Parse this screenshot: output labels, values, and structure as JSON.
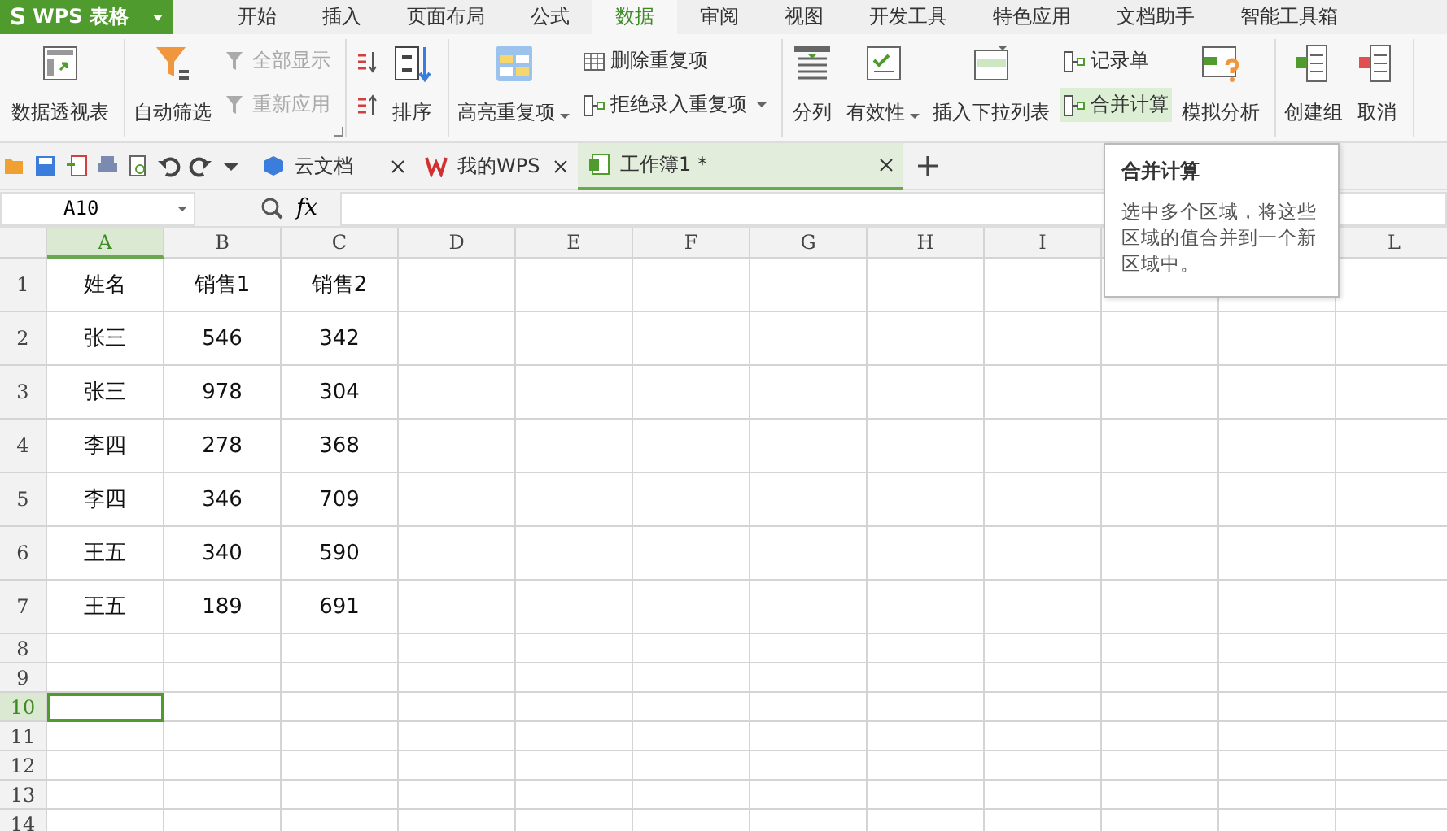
{
  "app": {
    "logo": "S",
    "title": "WPS 表格"
  },
  "menu_tabs": [
    {
      "label": "开始",
      "selected": false
    },
    {
      "label": "插入",
      "selected": false
    },
    {
      "label": "页面布局",
      "selected": false
    },
    {
      "label": "公式",
      "selected": false
    },
    {
      "label": "数据",
      "selected": true
    },
    {
      "label": "审阅",
      "selected": false
    },
    {
      "label": "视图",
      "selected": false
    },
    {
      "label": "开发工具",
      "selected": false
    },
    {
      "label": "特色应用",
      "selected": false
    },
    {
      "label": "文档助手",
      "selected": false
    },
    {
      "label": "智能工具箱",
      "selected": false
    }
  ],
  "ribbon": [
    {
      "items": [
        {
          "kind": "large",
          "label": "数据透视表"
        }
      ]
    },
    {
      "launcher": true,
      "items": [
        {
          "kind": "large",
          "label": "自动筛选"
        },
        {
          "kind": "stack",
          "items": [
            {
              "label": "全部显示",
              "disabled": true
            },
            {
              "label": "重新应用",
              "disabled": true
            }
          ]
        }
      ]
    },
    {
      "items": [
        {
          "kind": "stack",
          "items": [
            {
              "kind": "ascending"
            },
            {
              "kind": "descending"
            }
          ]
        },
        {
          "kind": "large",
          "label": "排序"
        }
      ]
    },
    {
      "items": [
        {
          "kind": "large",
          "label": "高亮重复项",
          "dropdown": true
        },
        {
          "kind": "stack",
          "items": [
            {
              "label": "删除重复项"
            },
            {
              "label": "拒绝录入重复项",
              "dropdown": true
            }
          ]
        }
      ]
    },
    {
      "items": [
        {
          "kind": "large",
          "label": "分列"
        },
        {
          "kind": "large",
          "label": "有效性",
          "dropdown": true
        },
        {
          "kind": "large",
          "label": "插入下拉列表"
        },
        {
          "kind": "stack",
          "items": [
            {
              "label": "记录单"
            },
            {
              "label": "合并计算",
              "selected": true
            }
          ]
        },
        {
          "kind": "large",
          "label": "模拟分析"
        }
      ]
    },
    {
      "items": [
        {
          "kind": "large",
          "label": "创建组"
        },
        {
          "kind": "large",
          "label": "取消"
        }
      ]
    }
  ],
  "doc_tabs": [
    {
      "label": "云文档",
      "selected": false
    },
    {
      "label": "我的WPS",
      "selected": false
    },
    {
      "label": "工作簿1 *",
      "selected": true
    }
  ],
  "name_box": "A10",
  "formula_label": "fx",
  "columns": [
    {
      "label": "A",
      "selected": true
    },
    {
      "label": "B",
      "selected": false
    },
    {
      "label": "C",
      "selected": false
    },
    {
      "label": "D",
      "selected": false
    },
    {
      "label": "E",
      "selected": false
    },
    {
      "label": "F",
      "selected": false
    },
    {
      "label": "G",
      "selected": false
    },
    {
      "label": "H",
      "selected": false
    },
    {
      "label": "I",
      "selected": false
    },
    {},
    {},
    {
      "label": "L",
      "selected": false
    }
  ],
  "rows": [
    {
      "number": "1",
      "kind": "tall",
      "selected": false,
      "cells": [
        "姓名",
        "销售1",
        "销售2"
      ]
    },
    {
      "number": "2",
      "kind": "tall",
      "selected": false,
      "cells": [
        "张三",
        "546",
        "342"
      ]
    },
    {
      "number": "3",
      "kind": "tall",
      "selected": false,
      "cells": [
        "张三",
        "978",
        "304"
      ]
    },
    {
      "number": "4",
      "kind": "tall",
      "selected": false,
      "cells": [
        "李四",
        "278",
        "368"
      ]
    },
    {
      "number": "5",
      "kind": "tall",
      "selected": false,
      "cells": [
        "李四",
        "346",
        "709"
      ]
    },
    {
      "number": "6",
      "kind": "tall",
      "selected": false,
      "cells": [
        "王五",
        "340",
        "590"
      ]
    },
    {
      "number": "7",
      "kind": "tall",
      "selected": false,
      "cells": [
        "王五",
        "189",
        "691"
      ]
    },
    {
      "number": "8",
      "kind": "short",
      "selected": false
    },
    {
      "number": "9",
      "kind": "short",
      "selected": false
    },
    {
      "number": "10",
      "kind": "short",
      "selected": true
    },
    {
      "number": "11",
      "kind": "short",
      "selected": false
    },
    {
      "number": "12",
      "kind": "short",
      "selected": false
    },
    {
      "number": "13",
      "kind": "short",
      "selected": false
    },
    {
      "number": "14",
      "kind": "short",
      "selected": false
    }
  ],
  "tooltip": {
    "title": "合并计算",
    "text": "选中多个区域，将这些区域的值合并到一个新区域中。"
  }
}
